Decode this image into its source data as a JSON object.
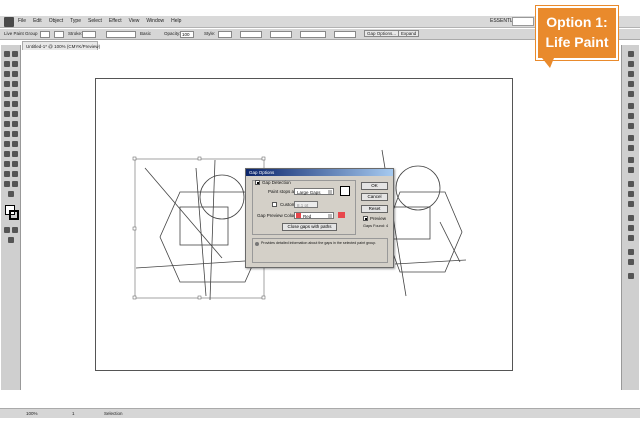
{
  "menubar": {
    "items": [
      "File",
      "Edit",
      "Object",
      "Type",
      "Select",
      "Effect",
      "View",
      "Window",
      "Help"
    ],
    "workspace": "ESSENTIALS"
  },
  "controlbar": {
    "selection": "Live Paint Group",
    "stroke_label": "Stroke:",
    "brush_label": "Basic",
    "opacity_label": "Opacity:",
    "opacity_value": "100",
    "style_label": "Style:",
    "gap_button": "Gap Options...",
    "expand_button": "Expand"
  },
  "document": {
    "tab_label": "Untitled-1* @ 100% (CMYK/Preview)"
  },
  "callout": {
    "line1": "Option 1:",
    "line2": "Life Paint",
    "color": "#e98a2c"
  },
  "dialog": {
    "title": "Gap Options",
    "gap_detection_label": "Gap Detection",
    "paint_stops_label": "Paint stops at:",
    "paint_stops_value": "Large Gaps",
    "custom_label": "Custom:",
    "custom_value": "8.1 pt",
    "gap_color_label": "Gap Preview Color:",
    "gap_color_value": "Red",
    "gap_color": "#e8474c",
    "close_gaps_button": "Close gaps with paths",
    "ok_button": "OK",
    "cancel_button": "Cancel",
    "reset_button": "Reset",
    "preview_label": "Preview",
    "gaps_found": "Gaps Found: 4",
    "note": "Provides detailed information about the gaps in the selected paint group."
  },
  "status": {
    "zoom": "100%",
    "page": "1",
    "mode": "Selection"
  }
}
